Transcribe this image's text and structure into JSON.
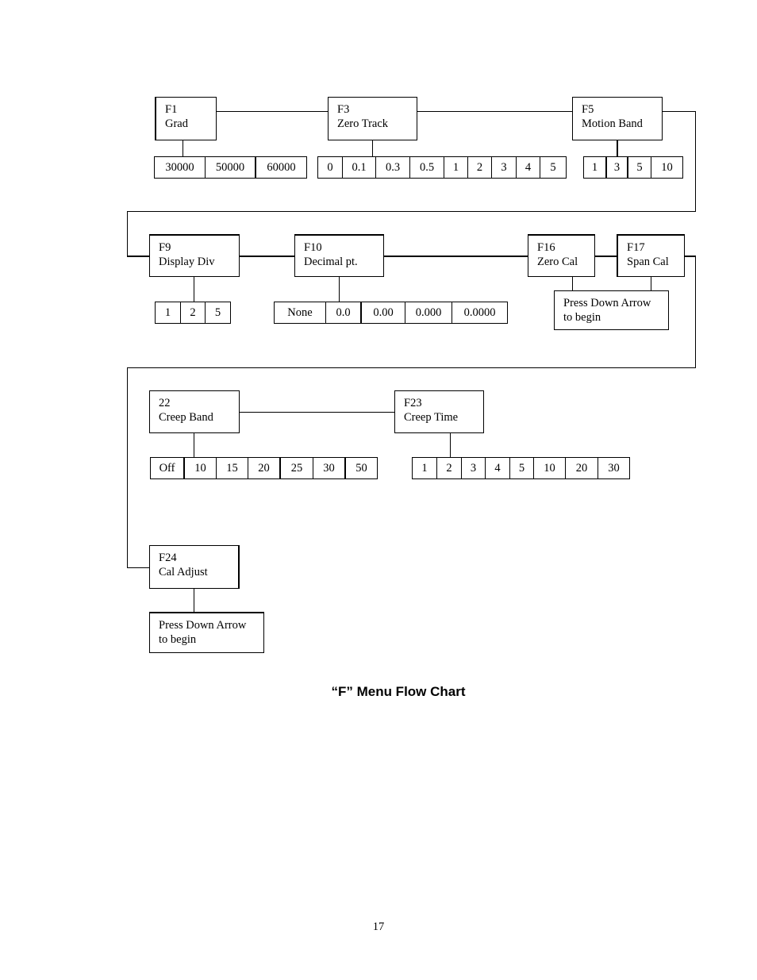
{
  "diagram": {
    "title": "“F” Menu Flow Chart",
    "page_number": "17",
    "nodes": {
      "f1": {
        "code": "F1",
        "name": "Grad",
        "options": [
          "30000",
          "50000",
          "60000"
        ]
      },
      "f3": {
        "code": "F3",
        "name": "Zero Track",
        "options": [
          "0",
          "0.1",
          "0.3",
          "0.5",
          "1",
          "2",
          "3",
          "4",
          "5"
        ]
      },
      "f5": {
        "code": "F5",
        "name": "Motion Band",
        "options": [
          "1",
          "3",
          "5",
          "10"
        ]
      },
      "f9": {
        "code": "F9",
        "name": "Display Div",
        "options": [
          "1",
          "2",
          "5"
        ]
      },
      "f10": {
        "code": "F10",
        "name": "Decimal pt.",
        "options": [
          "None",
          "0.0",
          "0.00",
          "0.000",
          "0.0000"
        ]
      },
      "f16": {
        "code": "F16",
        "name": "Zero Cal"
      },
      "f17": {
        "code": "F17",
        "name": "Span Cal"
      },
      "f16_f17_action": {
        "line1": "Press Down Arrow",
        "line2": "to begin"
      },
      "f22": {
        "code": "22",
        "name": "Creep Band",
        "options": [
          "Off",
          "10",
          "15",
          "20",
          "25",
          "30",
          "50"
        ]
      },
      "f23": {
        "code": "F23",
        "name": "Creep Time",
        "options": [
          "1",
          "2",
          "3",
          "4",
          "5",
          "10",
          "20",
          "30"
        ]
      },
      "f24": {
        "code": "F24",
        "name": "Cal Adjust"
      },
      "f24_action": {
        "line1": "Press Down Arrow",
        "line2": "to begin"
      }
    }
  }
}
